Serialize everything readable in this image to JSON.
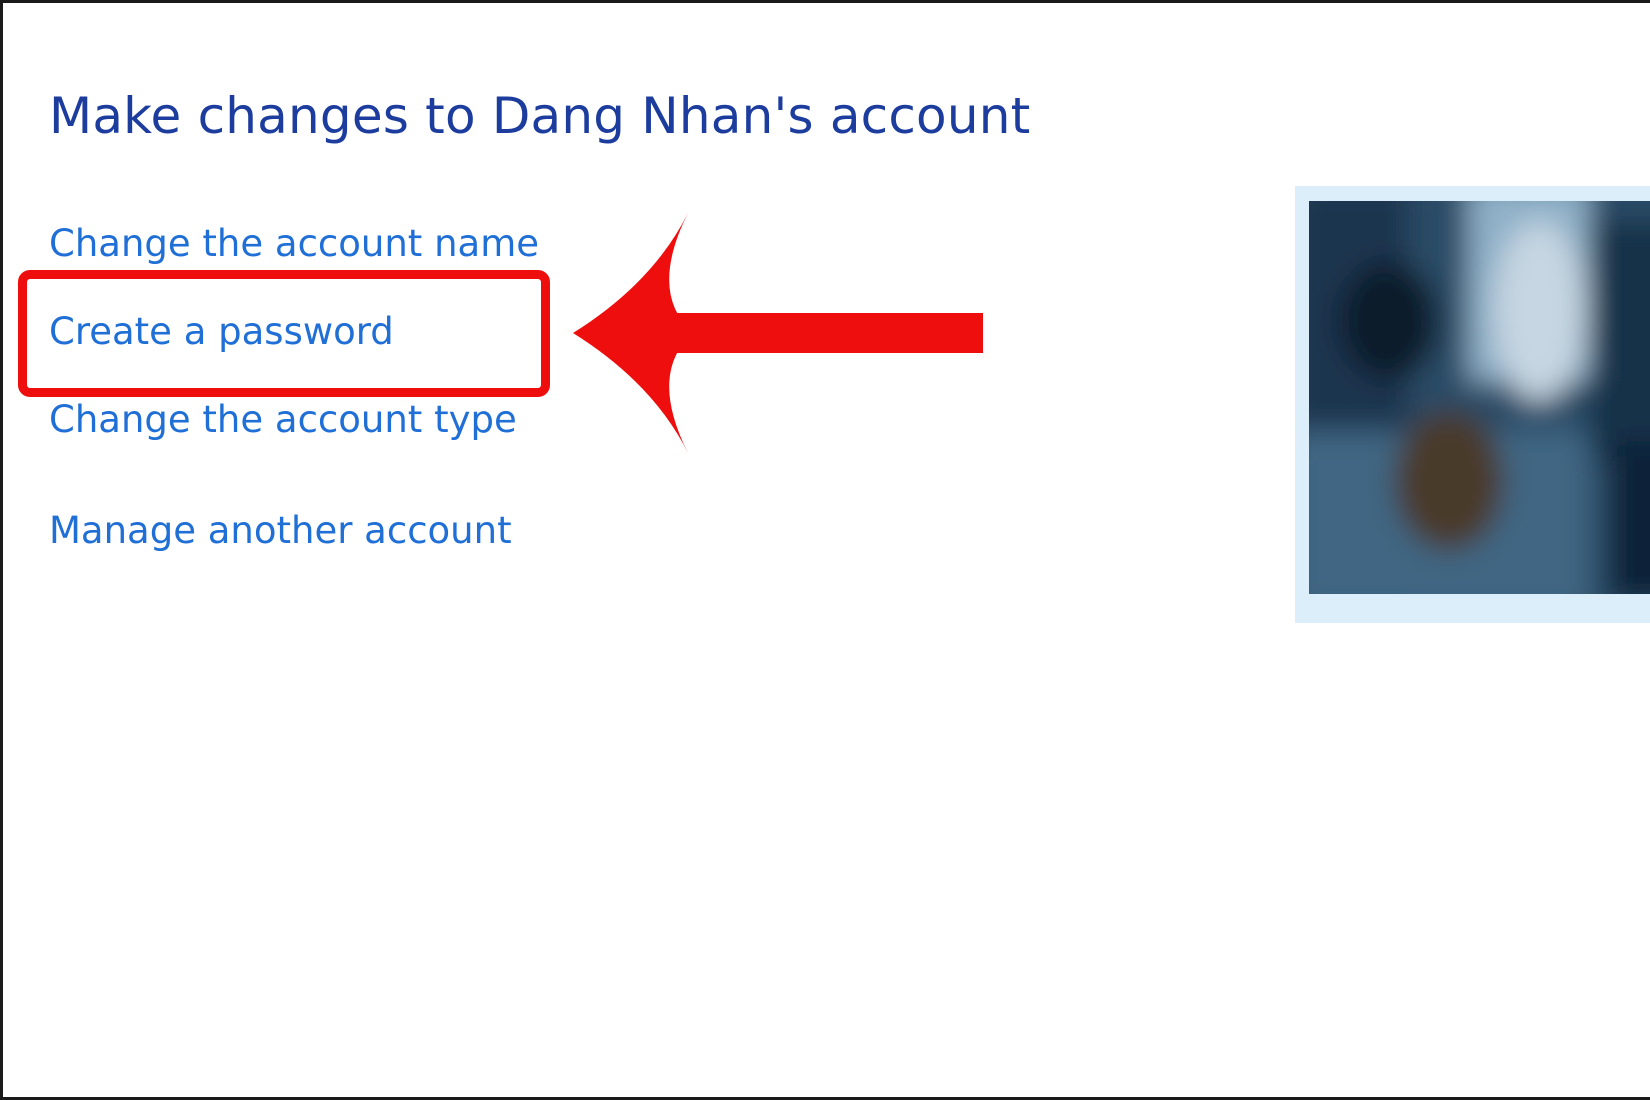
{
  "page": {
    "title": "Make changes to Dang Nhan's account"
  },
  "tasks": [
    {
      "label": "Change the account name"
    },
    {
      "label": "Create a password"
    },
    {
      "label": "Change the account type"
    },
    {
      "label": "Manage another account"
    }
  ],
  "annotation": {
    "highlighted_task": "Create a password",
    "color": "#ee0e0e"
  },
  "colors": {
    "title": "#1c3c9e",
    "link": "#1f6fd6",
    "avatar_frame": "#dbeefa"
  },
  "icons": {
    "callout": "arrow-left-icon",
    "avatar": "user-avatar-blurred"
  }
}
